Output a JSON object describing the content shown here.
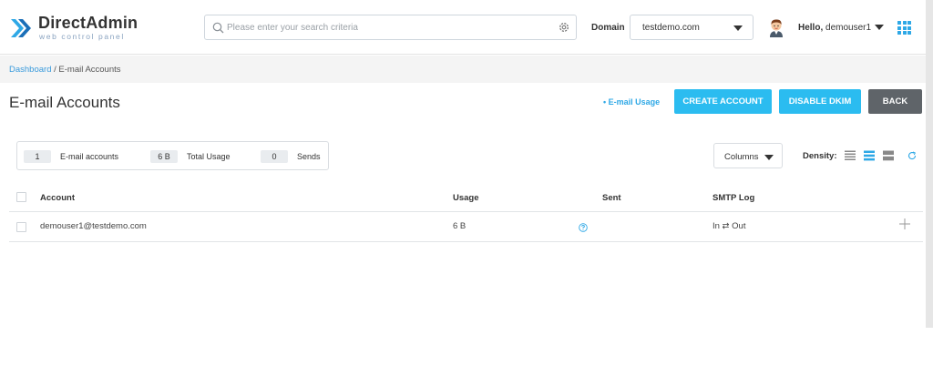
{
  "header": {
    "logo_name": "DirectAdmin",
    "logo_tagline": "web control panel",
    "search_placeholder": "Please enter your search criteria",
    "domain_label": "Domain",
    "domain_value": "testdemo.com",
    "greeting": "Hello,",
    "username": "demouser1"
  },
  "breadcrumb": {
    "home": "Dashboard",
    "separator": " / ",
    "current": "E-mail Accounts"
  },
  "page": {
    "title": "E-mail Accounts",
    "usage_link": "• E-mail Usage",
    "buttons": {
      "create": "CREATE ACCOUNT",
      "dkim": "DISABLE DKIM",
      "back": "BACK"
    }
  },
  "stats": [
    {
      "value": "1",
      "label": "E-mail accounts"
    },
    {
      "value": "6 B",
      "label": "Total Usage"
    },
    {
      "value": "0",
      "label": "Sends"
    }
  ],
  "toolbar": {
    "columns_label": "Columns",
    "density_label": "Density:"
  },
  "table": {
    "columns": [
      "Account",
      "Usage",
      "Sent",
      "SMTP Log"
    ],
    "rows": [
      {
        "account": "demouser1@testdemo.com",
        "usage": "6 B",
        "smtp_log": "In ⇄ Out"
      }
    ]
  },
  "colors": {
    "accent": "#2bbcf0",
    "back_button": "#5f6469",
    "link": "#3a9bdc"
  },
  "icons": {
    "search": "search-icon",
    "gear": "gear-icon",
    "caret": "caret-down-icon",
    "apps": "apps-grid-icon",
    "help": "help-circle-icon",
    "expand": "plus-icon",
    "refresh": "refresh-icon"
  }
}
